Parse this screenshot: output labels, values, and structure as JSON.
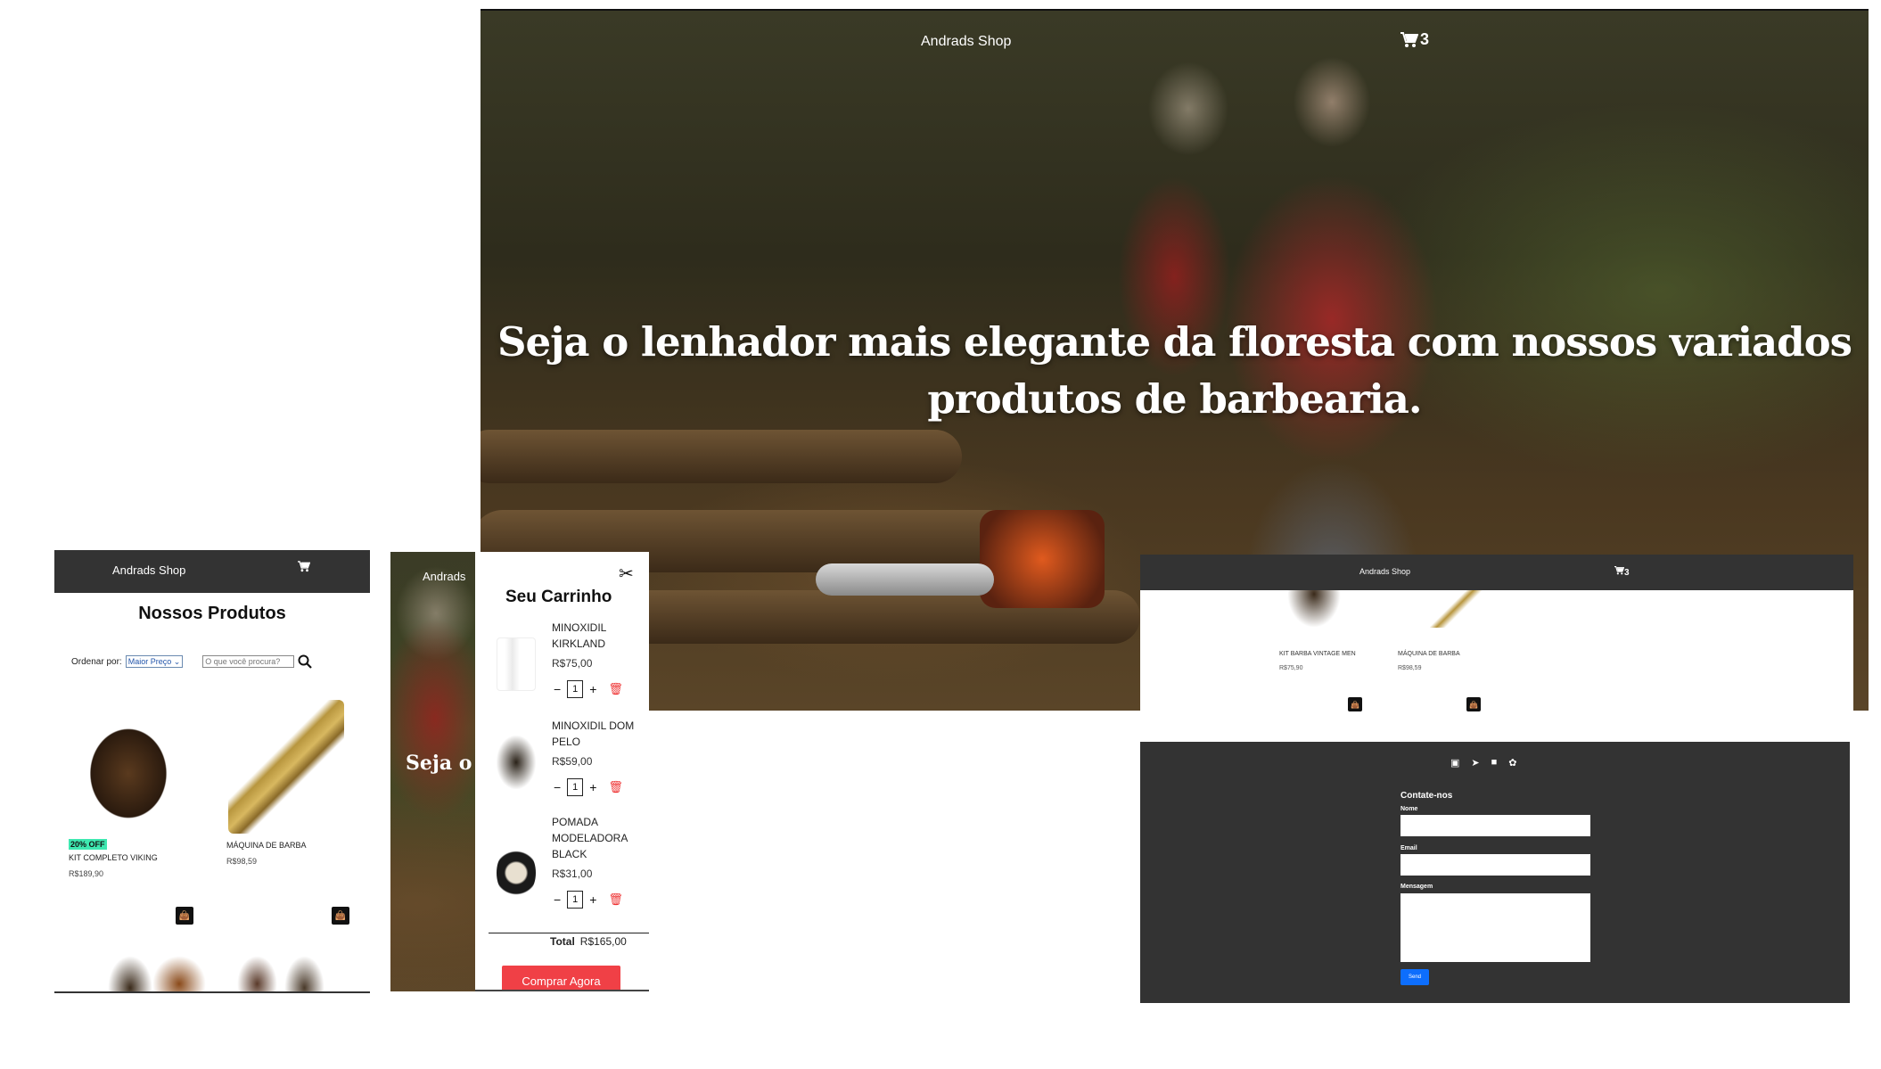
{
  "hero": {
    "brand": "Andrads Shop",
    "cart_count": "3",
    "headline": "Seja o lenhador mais elegante da floresta com nossos variados produtos de barbearia."
  },
  "mobile_catalog": {
    "brand": "Andrads Shop",
    "title": "Nossos Produtos",
    "sort_label": "Ordenar por:",
    "sort_value": "Maior Preço",
    "search_placeholder": "O que você procura?",
    "products": [
      {
        "badge": "20% OFF",
        "name": "KIT COMPLETO VIKING",
        "price": "R$189,90"
      },
      {
        "badge": "",
        "name": "MÁQUINA DE BARBA",
        "price": "R$98,59"
      }
    ]
  },
  "mobile_cart": {
    "brand_partial": "Andrads",
    "headline_partial": "Seja o elegar com no",
    "title": "Seu Carrinho",
    "items": [
      {
        "name": "MINOXIDIL KIRKLAND",
        "price": "R$75,00",
        "qty": "1"
      },
      {
        "name": "MINOXIDIL DOM PELO",
        "price": "R$59,00",
        "qty": "1"
      },
      {
        "name": "POMADA MODELADORA BLACK",
        "price": "R$31,00",
        "qty": "1"
      }
    ],
    "total_label": "Total",
    "total_value": "R$165,00",
    "buy_label": "Comprar Agora"
  },
  "desktop_strip": {
    "brand": "Andrads Shop",
    "cart_count": "3",
    "products": [
      {
        "name": "KIT BARBA VINTAGE MEN",
        "price": "R$75,90"
      },
      {
        "name": "MÁQUINA DE BARBA",
        "price": "R$98,59"
      }
    ]
  },
  "footer": {
    "social_icons": [
      "instagram-icon",
      "telegram-icon",
      "facebook-icon",
      "twitter-icon"
    ],
    "contact_title": "Contate-nos",
    "name_label": "Nome",
    "email_label": "Email",
    "message_label": "Mensagem",
    "send_label": "Send"
  },
  "colors": {
    "nav_bg": "#333333",
    "badge": "#3ee8b0",
    "buy_button": "#f04046",
    "send_button": "#0d6efd",
    "trash": "#ee3333"
  }
}
